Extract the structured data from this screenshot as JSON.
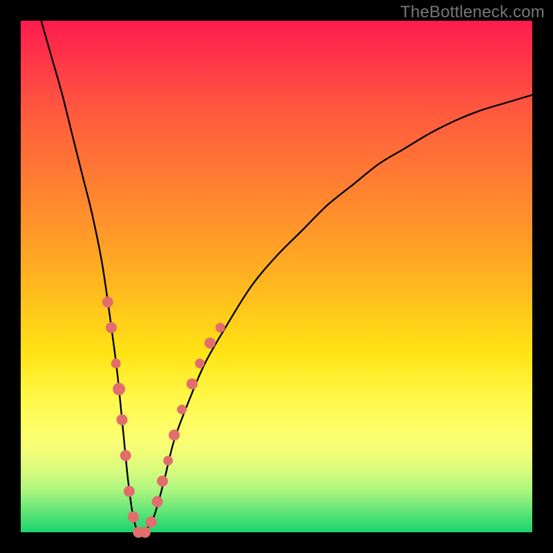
{
  "watermark": "TheBottleneck.com",
  "colors": {
    "curve_stroke": "#000000",
    "marker_fill": "#e36d6d",
    "marker_stroke": "#d85c5c",
    "frame": "#000000"
  },
  "chart_data": {
    "type": "line",
    "title": "",
    "xlabel": "",
    "ylabel": "",
    "xlim": [
      0,
      100
    ],
    "ylim": [
      0,
      100
    ],
    "grid": false,
    "series": [
      {
        "name": "bottleneck-curve",
        "x": [
          4,
          6,
          8,
          10,
          12,
          14,
          16,
          18,
          19,
          20,
          21,
          22,
          23,
          24,
          26,
          28,
          30,
          33,
          36,
          40,
          45,
          50,
          55,
          60,
          65,
          70,
          75,
          80,
          85,
          90,
          95,
          100
        ],
        "values": [
          100,
          93,
          86,
          78,
          70,
          62,
          52,
          38,
          30,
          20,
          10,
          3,
          0,
          0,
          3,
          10,
          18,
          26,
          33,
          40,
          48,
          54,
          59,
          64,
          68,
          72,
          75,
          78,
          80.5,
          82.5,
          84,
          85.5
        ]
      }
    ],
    "markers": {
      "name": "highlight-points",
      "color": "#e36d6d",
      "points": [
        {
          "x": 17.0,
          "y": 45,
          "r": 8
        },
        {
          "x": 17.7,
          "y": 40,
          "r": 8
        },
        {
          "x": 18.6,
          "y": 33,
          "r": 7
        },
        {
          "x": 19.2,
          "y": 28,
          "r": 9
        },
        {
          "x": 19.8,
          "y": 22,
          "r": 8
        },
        {
          "x": 20.5,
          "y": 15,
          "r": 8
        },
        {
          "x": 21.2,
          "y": 8,
          "r": 8
        },
        {
          "x": 22.0,
          "y": 3,
          "r": 8
        },
        {
          "x": 23.0,
          "y": 0,
          "r": 8
        },
        {
          "x": 24.3,
          "y": 0,
          "r": 8
        },
        {
          "x": 25.5,
          "y": 2,
          "r": 8
        },
        {
          "x": 26.7,
          "y": 6,
          "r": 8
        },
        {
          "x": 27.7,
          "y": 10,
          "r": 8
        },
        {
          "x": 28.8,
          "y": 14,
          "r": 7
        },
        {
          "x": 30.0,
          "y": 19,
          "r": 8
        },
        {
          "x": 31.5,
          "y": 24,
          "r": 7
        },
        {
          "x": 33.5,
          "y": 29,
          "r": 8
        },
        {
          "x": 35.0,
          "y": 33,
          "r": 7
        },
        {
          "x": 37.0,
          "y": 37,
          "r": 8
        },
        {
          "x": 39.0,
          "y": 40,
          "r": 7
        }
      ]
    }
  }
}
